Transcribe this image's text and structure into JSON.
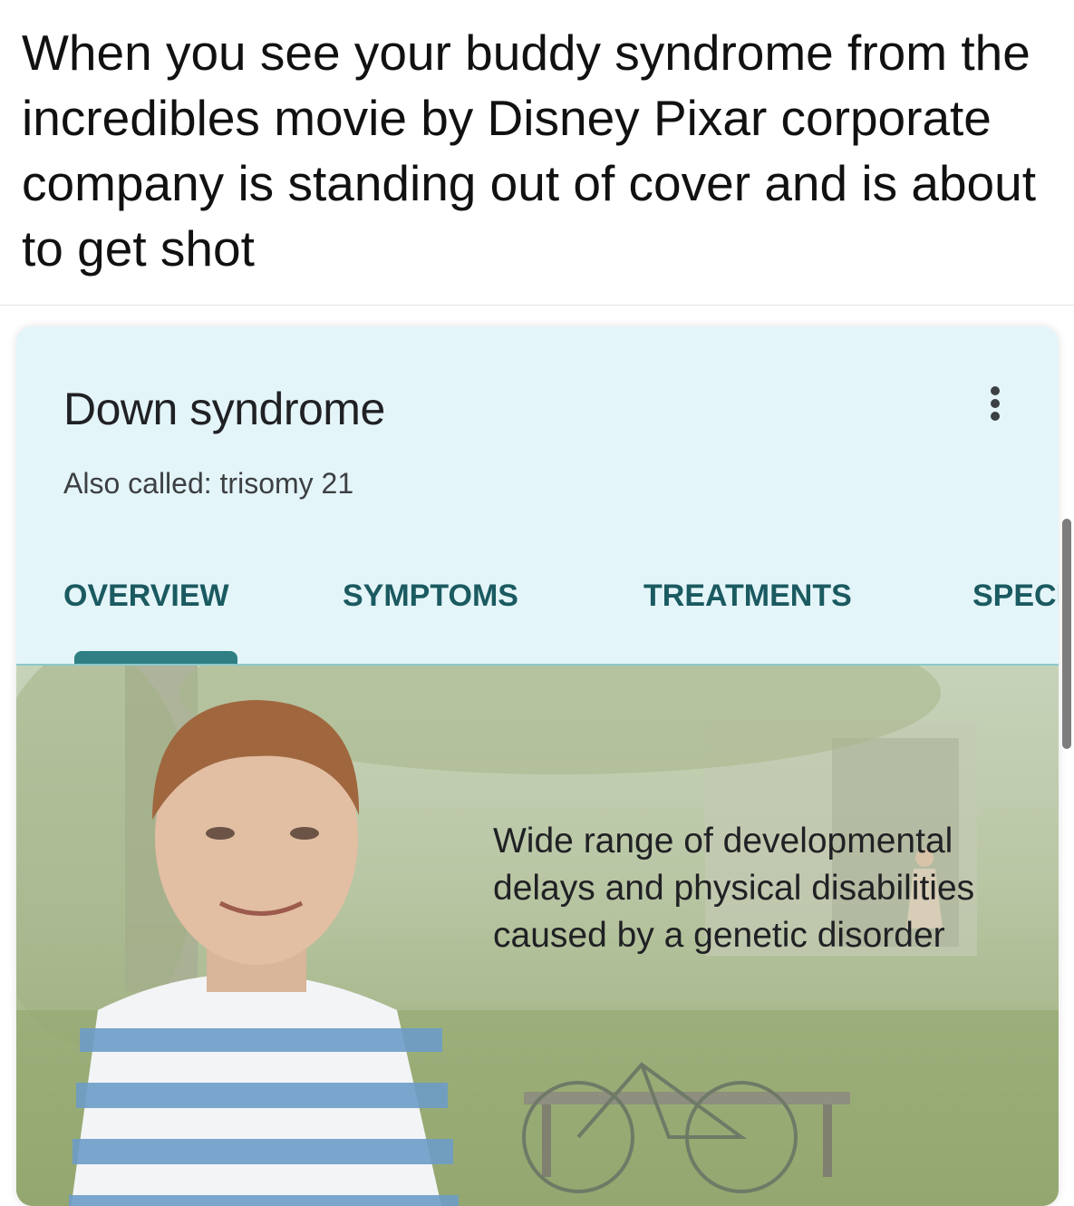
{
  "caption": {
    "text": "When you see your buddy syndrome from the incredibles movie by Disney Pixar corporate company is standing out of cover and is about to get shot"
  },
  "knowledge_panel": {
    "title": "Down syndrome",
    "subtitle": "Also called: trisomy 21",
    "more_icon": "more-vert-icon",
    "tabs": [
      {
        "label": "OVERVIEW",
        "selected": true
      },
      {
        "label": "SYMPTOMS",
        "selected": false
      },
      {
        "label": "TREATMENTS",
        "selected": false
      },
      {
        "label": "SPECIALISTS",
        "selected": false
      }
    ],
    "hero": {
      "description": "Wide range of developmental delays and physical disabilities caused by a genetic disorder"
    },
    "colors": {
      "header_bg": "#e4f5f9",
      "tab_text": "#1a5a60",
      "tab_indicator": "#2f7f85"
    }
  }
}
